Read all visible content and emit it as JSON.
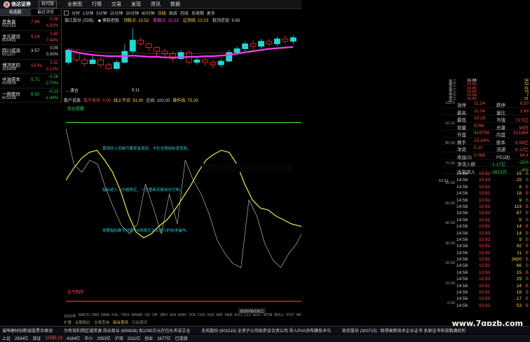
{
  "app": {
    "logo_text": "信达证券",
    "version_btn": "现代版"
  },
  "menu": [
    "全景图",
    "行情",
    "交易",
    "发现",
    "资讯",
    "数据"
  ],
  "watchlist": {
    "tabs": [
      "自选股",
      "最近浏览"
    ],
    "rows": [
      {
        "name": "恶意臭",
        "code": "002161",
        "price": "7.69",
        "chg": "0.36",
        "pct": "4.91%",
        "dir": "up"
      },
      {
        "name": "龙元建设",
        "code": "600491",
        "price": "9.24",
        "chg": "0.60",
        "pct": "7.44%",
        "dir": "up"
      },
      {
        "name": "四川成渝",
        "code": "601107",
        "price": "3.57",
        "chg": "0.00",
        "pct": "0.00%",
        "dir": "flat"
      },
      {
        "name": "博济医药",
        "code": "300404",
        "price": "15.41",
        "chg": "0.32",
        "pct": "2.12%",
        "dir": "up"
      },
      {
        "name": "中油资本",
        "code": "000609",
        "price": "5.71",
        "chg": "-0.16",
        "pct": "-2.73%",
        "dir": "down"
      },
      {
        "name": "一拖股份",
        "code": "601038",
        "price": "8.92",
        "chg": "-0.13",
        "pct": "-1.44%",
        "dir": "down"
      }
    ]
  },
  "timeframes": [
    "分时",
    "1分钟",
    "5分钟",
    "15分钟",
    "30分钟",
    "60分钟",
    "日线",
    "周线",
    "月线",
    "多周期",
    "更多"
  ],
  "active_tf": "日线",
  "kline": {
    "legend": [
      {
        "text": "银江股份 (日线)",
        "color": "#cfcfcf"
      },
      {
        "text": "◆ 摸鞋把肩",
        "color": "#cfcfcf"
      },
      {
        "text": "顶鞋点: 10.52",
        "color": "#ffd24a"
      },
      {
        "text": "鞋鞋点: 10.23",
        "color": "#ff55ff"
      },
      {
        "text": "边顶线: 10.23",
        "color": "#ffd24a"
      },
      {
        "text": "鞋顶逆逝: 9.88",
        "color": "#cfcfcf"
      }
    ],
    "low_label": "9.11",
    "back_label": "←清仓",
    "ma1": [
      60,
      56,
      54,
      52,
      51,
      50,
      50,
      50,
      51,
      50,
      49,
      49,
      48,
      48,
      48,
      49,
      49,
      50,
      50,
      51,
      52,
      54,
      56,
      58,
      60,
      62,
      63,
      64,
      65
    ],
    "ma2": [
      63,
      60,
      58,
      57,
      56,
      55,
      55,
      55,
      55,
      55,
      54,
      54,
      54,
      54,
      54,
      54,
      54,
      55,
      55,
      55,
      56,
      57,
      58,
      59,
      60,
      61,
      62,
      63,
      64
    ],
    "candles": [
      [
        40,
        60,
        36,
        62,
        "c"
      ],
      [
        56,
        44,
        40,
        60,
        "u"
      ],
      [
        44,
        38,
        34,
        48,
        "u"
      ],
      [
        38,
        44,
        36,
        50,
        "d"
      ],
      [
        44,
        36,
        32,
        48,
        "u"
      ],
      [
        36,
        30,
        28,
        40,
        "u"
      ],
      [
        30,
        40,
        28,
        44,
        "d"
      ],
      [
        40,
        58,
        38,
        70,
        "d"
      ],
      [
        58,
        76,
        54,
        96,
        "d"
      ],
      [
        76,
        70,
        66,
        80,
        "u"
      ],
      [
        70,
        64,
        58,
        72,
        "u"
      ],
      [
        64,
        58,
        50,
        66,
        "u"
      ],
      [
        58,
        54,
        48,
        62,
        "u"
      ],
      [
        54,
        46,
        40,
        58,
        "u"
      ],
      [
        46,
        56,
        44,
        60,
        "d"
      ],
      [
        56,
        40,
        36,
        60,
        "u"
      ],
      [
        40,
        44,
        36,
        48,
        "d"
      ],
      [
        44,
        40,
        34,
        48,
        "u"
      ],
      [
        40,
        36,
        30,
        44,
        "u"
      ],
      [
        36,
        42,
        32,
        46,
        "d"
      ],
      [
        42,
        56,
        40,
        60,
        "d"
      ],
      [
        56,
        62,
        52,
        66,
        "d"
      ],
      [
        62,
        70,
        58,
        74,
        "d"
      ],
      [
        70,
        66,
        60,
        76,
        "u"
      ],
      [
        66,
        74,
        62,
        78,
        "d"
      ],
      [
        74,
        70,
        66,
        78,
        "u"
      ],
      [
        70,
        78,
        66,
        82,
        "d"
      ],
      [
        78,
        74,
        70,
        84,
        "u"
      ],
      [
        74,
        80,
        70,
        84,
        "d"
      ]
    ]
  },
  "osc": {
    "header": [
      {
        "text": "散户逃离",
        "color": "#cfcfcf"
      },
      {
        "text": "低于卖持: 0.00",
        "color": "#ff4a4a"
      },
      {
        "text": "线上不买: 91.00",
        "color": "#ffd24a"
      },
      {
        "text": "庄线: 100.00",
        "color": "#cfcfcf"
      },
      {
        "text": "操作线: 75.29",
        "color": "#ffd24a"
      }
    ],
    "top_label": "持仓提醒",
    "notes": [
      "黄线向上突破可量现金增加，卡位全面指标逢低吸。",
      "指标进入下方超卖区，一旦重新突破加仓打响。",
      "本期指标数字时值与K线相互交叉运行的技术操作。"
    ],
    "bottom_label": "正气制作",
    "yellow": [
      62,
      68,
      73,
      76,
      77,
      72,
      66,
      57,
      45,
      36,
      33,
      35,
      39,
      42,
      47,
      53,
      59,
      66,
      72,
      75,
      77,
      76,
      70,
      60,
      52,
      48,
      47,
      44,
      42,
      40,
      39,
      38,
      36,
      35,
      36,
      38,
      44,
      52,
      58,
      63,
      68,
      71,
      73,
      74,
      75
    ],
    "white": [
      88,
      70,
      66,
      72,
      70,
      58,
      48,
      39,
      35,
      40,
      60,
      48,
      35,
      55,
      40,
      72,
      62,
      55,
      45,
      32,
      25,
      20,
      18,
      52,
      44,
      30,
      22,
      18,
      25,
      30,
      38,
      40,
      50,
      56,
      62,
      72,
      45,
      50,
      48,
      100,
      60,
      95,
      35,
      100
    ],
    "ticks": [
      "100.0",
      "90.00",
      "80.00",
      "70.00",
      "60.00",
      "50.00",
      "40.00",
      "30.00",
      "20.00",
      "10.00",
      "0.00"
    ],
    "xdate": "2020/05/19/二",
    "xyear": "2020年",
    "xmark": "5",
    "xmark2": "6",
    "scale_side": "63.51"
  },
  "quote": {
    "rows": [
      {
        "l": "卖三",
        "v": "10.88",
        "r": "34",
        "c": "#ffffff"
      },
      {
        "l": "卖二",
        "v": "10.86",
        "r": "33",
        "c": "#ff4a4a"
      },
      {
        "l": "卖一",
        "v": "10.86",
        "r": "41",
        "c": "#ff4a4a"
      },
      {
        "l": "买三",
        "v": "10.85",
        "r": "79",
        "c": "#ff4a4a"
      },
      {
        "l": "买二",
        "v": "10.84",
        "r": "7",
        "c": "#ff4a4a"
      },
      {
        "l": "买一",
        "v": "10.86",
        "r": "31",
        "c": "#ff4a4a"
      }
    ],
    "stats": [
      {
        "l": "涨停",
        "v": "11.24",
        "l2": "跌停",
        "v2": "9.20"
      },
      {
        "l": "最高",
        "v": "11.24",
        "l2": "量比",
        "v2": "1.69"
      },
      {
        "l": "最低",
        "v": "10.26",
        "l2": "市值",
        "v2": "71.5亿"
      },
      {
        "l": "现量",
        "v": "9768",
        "l2": "总量",
        "v2": "94万"
      },
      {
        "l": "外盘",
        "v": "419709",
        "l2": "内盘",
        "v2": "521994"
      },
      {
        "l": "换手",
        "v": "15.34%",
        "l2": "股本",
        "v2": "6.56亿"
      },
      {
        "l": "净资",
        "v": "5.10",
        "l2": "流通",
        "v2": "6.12亿"
      },
      {
        "l": "收益(3)",
        "v": "0.085",
        "l2": "PE(动)",
        "v2": "64.4"
      }
    ],
    "flow1": {
      "label": "净流入额",
      "v": "-1.17亿",
      "p": "-11%"
    },
    "flow2": {
      "label": "大宗流入",
      "v": "-3823万",
      "p": "-4%"
    }
  },
  "ticks": [
    {
      "t": "14:56",
      "p": "10.92",
      "v": "15",
      "d": "B"
    },
    {
      "t": "14:56",
      "p": "10.93",
      "v": "25",
      "d": "S"
    },
    {
      "t": "14:56",
      "p": "10.91",
      "v": "8",
      "d": "B"
    },
    {
      "t": "14:56",
      "p": "10.92",
      "v": "18",
      "d": "B"
    },
    {
      "t": "14:56",
      "p": "10.92",
      "v": "9",
      "d": "S"
    },
    {
      "t": "14:56",
      "p": "10.92",
      "v": "119",
      "d": "B"
    },
    {
      "t": "14:56",
      "p": "10.93",
      "v": "67",
      "d": "B"
    },
    {
      "t": "14:56",
      "p": "10.92",
      "v": "5",
      "d": "S"
    },
    {
      "t": "14:56",
      "p": "10.92",
      "v": "14",
      "d": "B"
    },
    {
      "t": "14:56",
      "p": "10.93",
      "v": "14",
      "d": "B"
    },
    {
      "t": "14:56",
      "p": "10.92",
      "v": "9",
      "d": "S"
    },
    {
      "t": "14:56",
      "p": "10.92",
      "v": "42",
      "d": "B"
    },
    {
      "t": "14:56",
      "p": "10.92",
      "v": "11",
      "d": "B"
    },
    {
      "t": "14:56",
      "p": "10.92",
      "v": "2600",
      "d": "B"
    },
    {
      "t": "14:56",
      "p": "10.92",
      "v": "66",
      "d": "S"
    },
    {
      "t": "14:56",
      "p": "10.93",
      "v": "15",
      "d": "B"
    },
    {
      "t": "14:56",
      "p": "10.93",
      "v": "29",
      "d": "S"
    },
    {
      "t": "14:56",
      "p": "10.91",
      "v": "24",
      "d": "B"
    },
    {
      "t": "14:56",
      "p": "10.91",
      "v": "18",
      "d": "S"
    },
    {
      "t": "14:56",
      "p": "10.93",
      "v": "17",
      "d": "B"
    },
    {
      "t": "14:56",
      "p": "10.92",
      "v": "53",
      "d": "B"
    }
  ],
  "bottom_tabs": [
    "2020年",
    "MACD",
    "DMI",
    "DMA",
    "FSL",
    "TRIX",
    "BRAR",
    "CR",
    "VR",
    "OBV",
    "ASI",
    "EMV",
    "VOL-TDX",
    "RSI",
    "WR",
    "SAR",
    "KDJ",
    "CCI",
    "ROC",
    "MTM",
    "BOLL",
    "PSY",
    "MCST",
    "更多",
    "设置"
  ],
  "bottom_tabs2": [
    "扩展",
    "关联股价",
    "交易查询",
    "综合资讯",
    "行业资讯"
  ],
  "news": [
    "诚坤建材创新层股票合格池",
    "为有效利用区域资源  茂业商业 (600828) 拟1000万元在包头市设立全",
    "东风股份 (601515) 全资子公司拟参设合资公司 导入PVA涂布膜技术与",
    "凯伦股份 (300715) : 取得高新技术企业证书  系原证书有效期满后所"
  ],
  "status": [
    {
      "t": "上证",
      "c": "#dcdcdc"
    },
    {
      "t": "2934亿",
      "c": "#dcdcdc"
    },
    {
      "t": "深证",
      "c": "#dcdcdc"
    },
    {
      "t": "11585.19",
      "c": "#ff4a4a"
    },
    {
      "t": "4184亿",
      "c": "#dcdcdc"
    },
    {
      "t": "中小",
      "c": "#dcdcdc"
    },
    {
      "t": "2053亿",
      "c": "#dcdcdc"
    },
    {
      "t": "沪深",
      "c": "#dcdcdc"
    },
    {
      "t": "2111亿",
      "c": "#dcdcdc"
    },
    {
      "t": "创业",
      "c": "#dcdcdc"
    },
    {
      "t": "1677亿",
      "c": "#dcdcdc"
    },
    {
      "t": "已连接",
      "c": "#dcdcdc"
    }
  ],
  "watermark": "www.7gpzb.com"
}
